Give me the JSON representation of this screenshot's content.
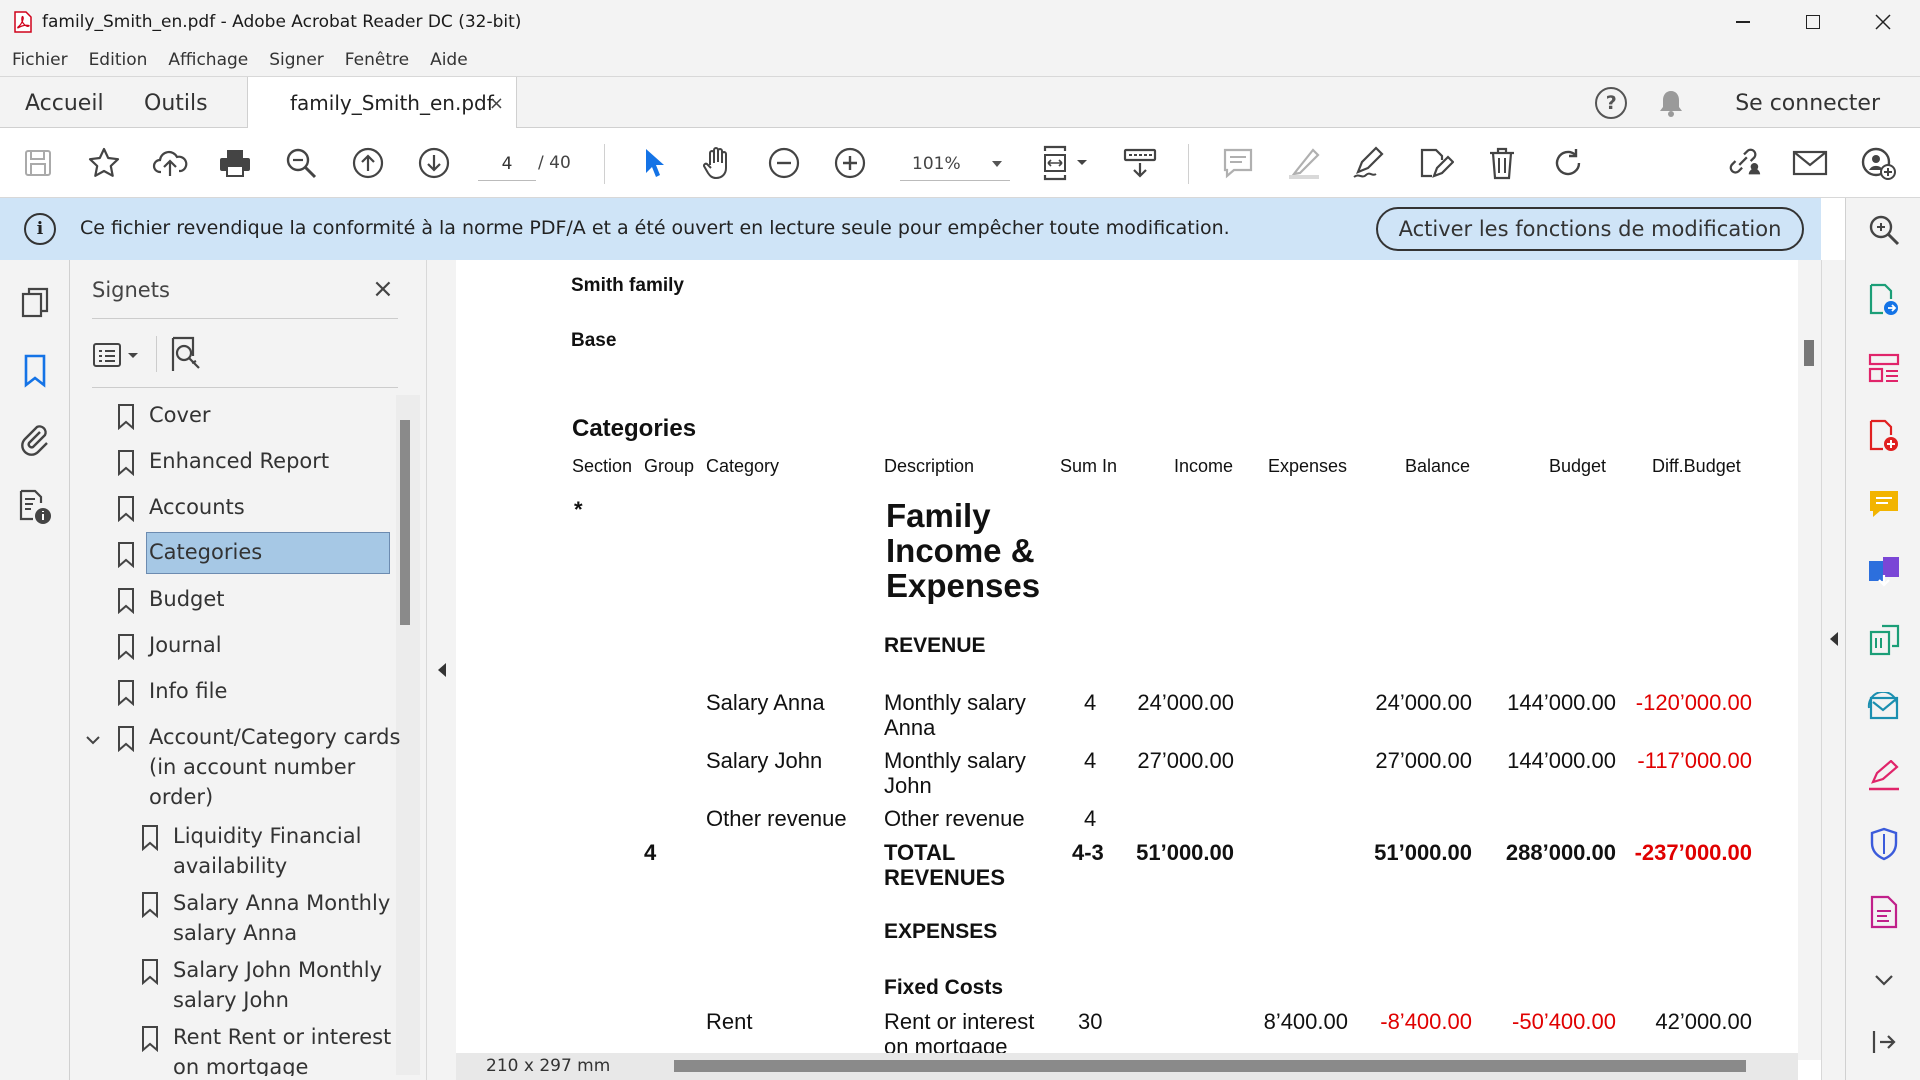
{
  "window": {
    "title": "family_Smith_en.pdf - Adobe Acrobat Reader DC (32-bit)"
  },
  "menu": [
    "Fichier",
    "Edition",
    "Affichage",
    "Signer",
    "Fenêtre",
    "Aide"
  ],
  "tabs": {
    "home": "Accueil",
    "tools": "Outils",
    "document": "family_Smith_en.pdf",
    "close": "×",
    "signin": "Se connecter"
  },
  "toolbar": {
    "page_current": "4",
    "page_total": "/  40",
    "zoom": "101%"
  },
  "banner": {
    "info": "i",
    "message": "Ce fichier revendique la conformité à la norme PDF/A et a été ouvert en lecture seule pour empêcher toute modification.",
    "button": "Activer les fonctions de modification"
  },
  "bookmarks": {
    "header": "Signets",
    "close": "×",
    "items": [
      {
        "label": "Cover"
      },
      {
        "label": "Enhanced Report"
      },
      {
        "label": "Accounts"
      },
      {
        "label": "Categories"
      },
      {
        "label": "Budget"
      },
      {
        "label": "Journal"
      },
      {
        "label": "Info file"
      },
      {
        "label": "Account/Category cards",
        "line2": "(in account number",
        "line3": "order)"
      },
      {
        "label": "Liquidity Financial",
        "line2": "availability"
      },
      {
        "label": "Salary Anna Monthly",
        "line2": "salary Anna"
      },
      {
        "label": "Salary John Monthly",
        "line2": "salary John"
      },
      {
        "label": "Rent Rent or interest",
        "line2": "on mortgage"
      }
    ]
  },
  "document": {
    "family": "Smith family",
    "base": "Base",
    "section_title": "Categories",
    "columns": [
      "Section",
      "Group",
      "Category",
      "Description",
      "Sum In",
      "Income",
      "Expenses",
      "Balance",
      "Budget",
      "Diff.Budget"
    ],
    "star": "*",
    "main_title": [
      "Family",
      "Income &",
      "Expenses"
    ],
    "revenue": "REVENUE",
    "rows": [
      {
        "category": "Salary Anna",
        "desc1": "Monthly salary",
        "desc2": "Anna",
        "sumin": "4",
        "income": "24’000.00",
        "expenses": "",
        "balance": "24’000.00",
        "budget": "144’000.00",
        "diff": "-120’000.00"
      },
      {
        "category": "Salary John",
        "desc1": "Monthly salary",
        "desc2": "John",
        "sumin": "4",
        "income": "27’000.00",
        "expenses": "",
        "balance": "27’000.00",
        "budget": "144’000.00",
        "diff": "-117’000.00"
      },
      {
        "category": "Other revenue",
        "desc1": "Other revenue",
        "desc2": "",
        "sumin": "4",
        "income": "",
        "expenses": "",
        "balance": "",
        "budget": "",
        "diff": ""
      }
    ],
    "total": {
      "group": "4",
      "desc1": "TOTAL",
      "desc2": "REVENUES",
      "sumin": "4-3",
      "income": "51’000.00",
      "balance": "51’000.00",
      "budget": "288’000.00",
      "diff": "-237’000.00"
    },
    "expenses": "EXPENSES",
    "fixed_costs": "Fixed Costs",
    "rent": {
      "category": "Rent",
      "desc1": "Rent or interest",
      "desc2": "on mortgage",
      "sumin": "30",
      "expenses": "8’400.00",
      "balance": "-8’400.00",
      "budget": "-50’400.00",
      "diff": "42’000.00"
    }
  },
  "status": {
    "dimensions": "210 x 297 mm"
  },
  "colors": {
    "banner": "#cfe4f7",
    "negative": "#e00000",
    "selection": "#a6c8e5",
    "accent_blue": "#1473e6"
  }
}
